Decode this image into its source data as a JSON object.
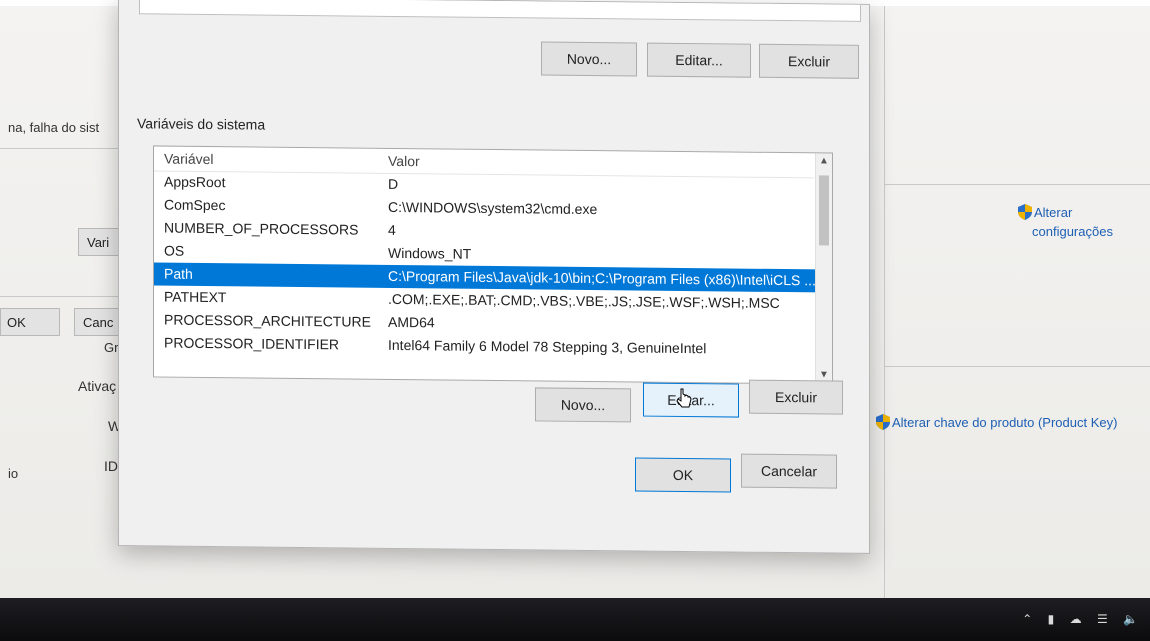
{
  "background": {
    "error_text": "na, falha do sist",
    "var_button": "Vari",
    "ok_button": "OK",
    "cancel_button": "Canc",
    "gr_text": "Gr",
    "activation_label": "Ativaç",
    "w_text": "W",
    "id_text": "ID",
    "io_text": "io",
    "change_settings_line1": "Alterar",
    "change_settings_line2": "configurações",
    "change_product_key": "Alterar chave do produto (Product Key)"
  },
  "dialog": {
    "user_buttons": {
      "new": "Novo...",
      "edit": "Editar...",
      "delete": "Excluir"
    },
    "system_section_label": "Variáveis do sistema",
    "columns": {
      "variable": "Variável",
      "value": "Valor"
    },
    "rows": [
      {
        "variable": "AppsRoot",
        "value": "D"
      },
      {
        "variable": "ComSpec",
        "value": "C:\\WINDOWS\\system32\\cmd.exe"
      },
      {
        "variable": "NUMBER_OF_PROCESSORS",
        "value": "4"
      },
      {
        "variable": "OS",
        "value": "Windows_NT"
      },
      {
        "variable": "Path",
        "value": "C:\\Program Files\\Java\\jdk-10\\bin;C:\\Program Files (x86)\\Intel\\iCLS ..."
      },
      {
        "variable": "PATHEXT",
        "value": ".COM;.EXE;.BAT;.CMD;.VBS;.VBE;.JS;.JSE;.WSF;.WSH;.MSC"
      },
      {
        "variable": "PROCESSOR_ARCHITECTURE",
        "value": "AMD64"
      },
      {
        "variable": "PROCESSOR_IDENTIFIER",
        "value": "Intel64 Family 6 Model 78 Stepping 3, GenuineIntel"
      }
    ],
    "selected_row": "Path",
    "system_buttons": {
      "new": "Novo...",
      "edit": "Editar...",
      "delete": "Excluir"
    },
    "ok": "OK",
    "cancel": "Cancelar"
  },
  "colors": {
    "selection": "#0078d7",
    "link": "#1e5fb4"
  },
  "icons": [
    "shield-icon",
    "scroll-up-icon",
    "scroll-down-icon",
    "mouse-cursor-icon"
  ]
}
